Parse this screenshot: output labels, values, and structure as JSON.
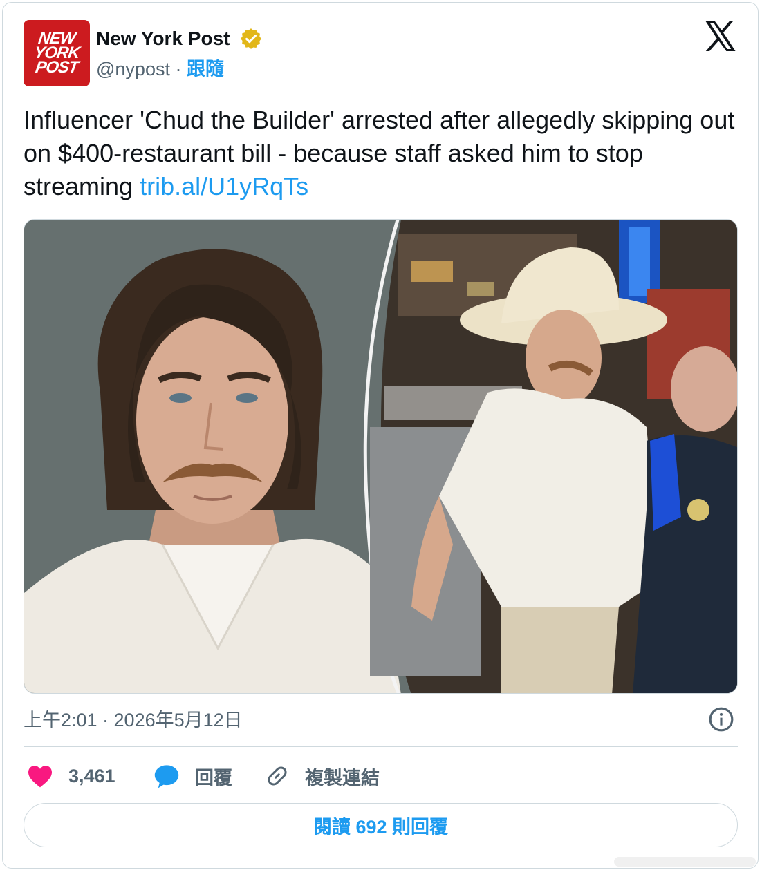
{
  "author": {
    "logo_lines": [
      "NEW",
      "YORK",
      "POST"
    ],
    "display_name": "New York Post",
    "handle": "@nypost",
    "separator": " · ",
    "follow_label": "跟隨",
    "verified_badge_color": "#e2b719"
  },
  "tweet": {
    "text": "Influencer 'Chud the Builder' arrested after allegedly skipping out on $400-restaurant bill - because staff asked him to stop streaming ",
    "link_text": "trib.al/U1yRqTs",
    "timestamp": "上午2:01 · 2026年5月12日"
  },
  "media": {
    "left_image": "mugshot of man with long brown hair and moustache against gray background, white knit shirt",
    "right_image": "man in white cowboy hat and white knit shirt standing on city street at night beside police officer"
  },
  "actions": {
    "like_count": "3,461",
    "reply_label": "回覆",
    "copy_link_label": "複製連結",
    "read_replies_label": "閱讀 692 則回覆"
  },
  "colors": {
    "accent": "#1d9bf0",
    "like": "#f91880",
    "text": "#0f1419",
    "muted": "#536471",
    "brand_red": "#cc1b1f"
  },
  "icons": {
    "verified": "verified-badge-icon",
    "platform": "x-logo-icon",
    "info": "info-icon",
    "like": "heart-icon",
    "reply": "speech-bubble-icon",
    "copy": "link-icon"
  }
}
